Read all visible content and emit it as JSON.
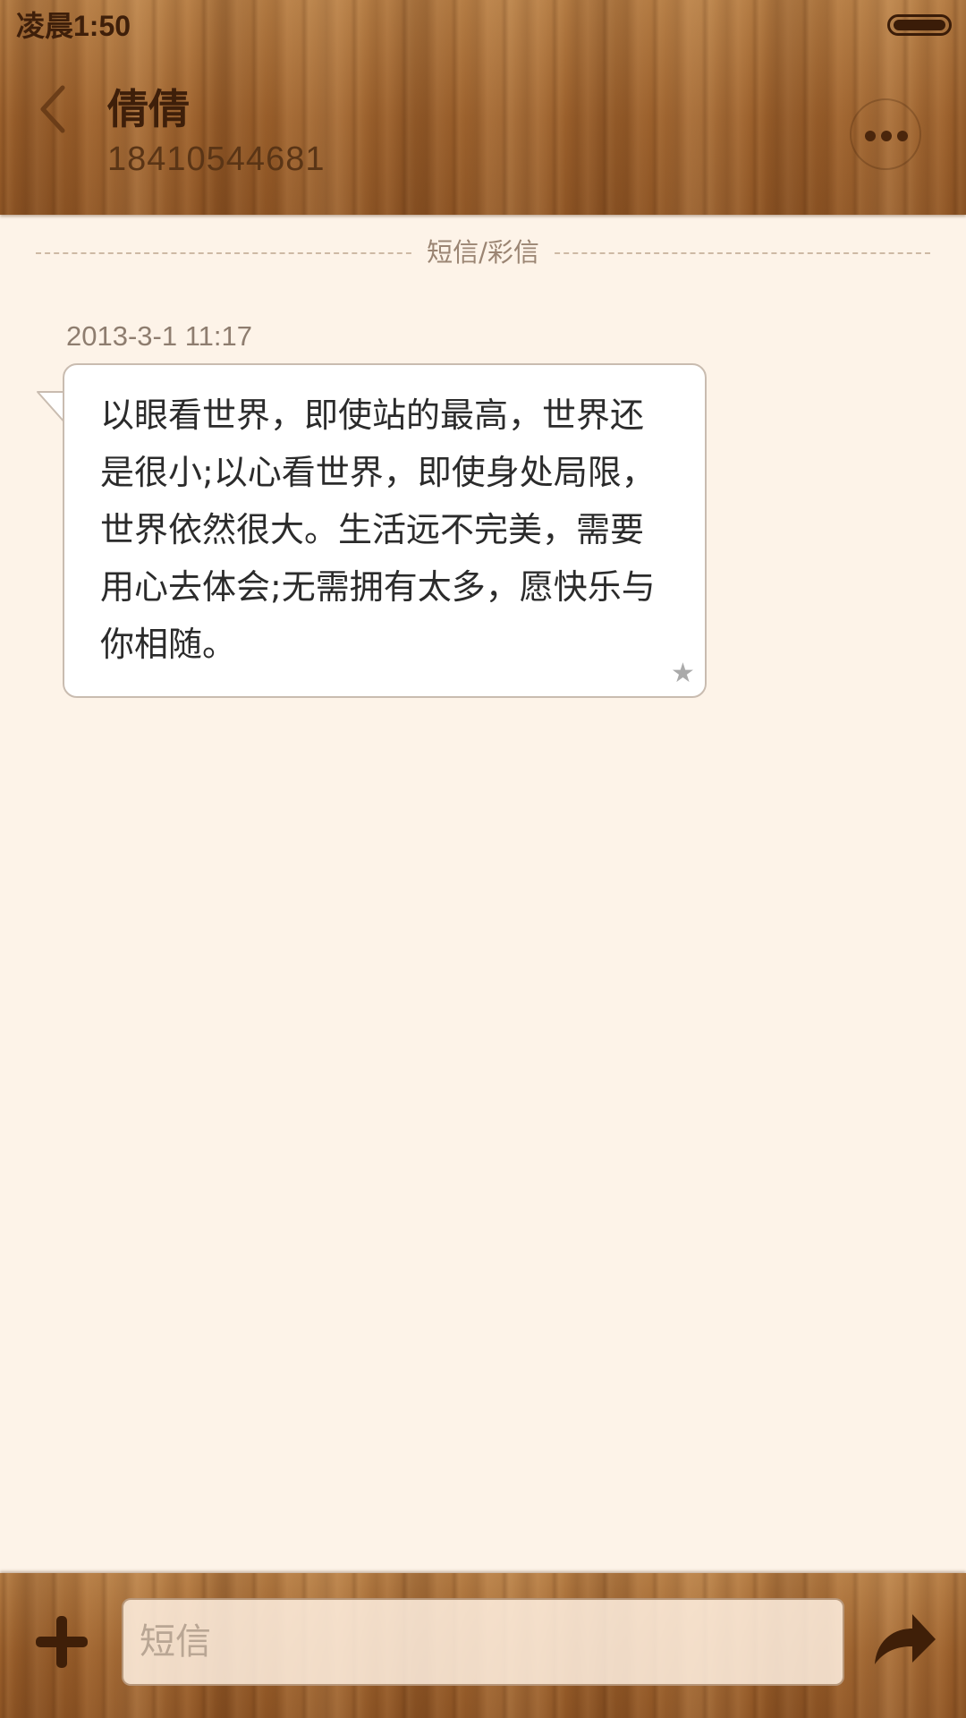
{
  "status_bar": {
    "time": "凌晨1:50"
  },
  "header": {
    "contact_name": "倩倩",
    "contact_number": "18410544681",
    "back_icon": "chevron-left-icon",
    "more_icon": "more-horizontal-icon"
  },
  "thread": {
    "separator_label": "短信/彩信",
    "messages": [
      {
        "timestamp": "2013-3-1 11:17",
        "text": "以眼看世界，即使站的最高，世界还是很小;以心看世界，即使身处局限，世界依然很大。生活远不完美，需要用心去体会;无需拥有太多，愿快乐与你相随。",
        "starred_icon": "star-icon"
      }
    ]
  },
  "compose": {
    "placeholder": "短信",
    "attach_icon": "plus-icon",
    "send_icon": "send-arrow-icon"
  },
  "colors": {
    "wood": "#9c622d",
    "background": "#fdf3e8",
    "dark_text": "#3e1f0a"
  }
}
